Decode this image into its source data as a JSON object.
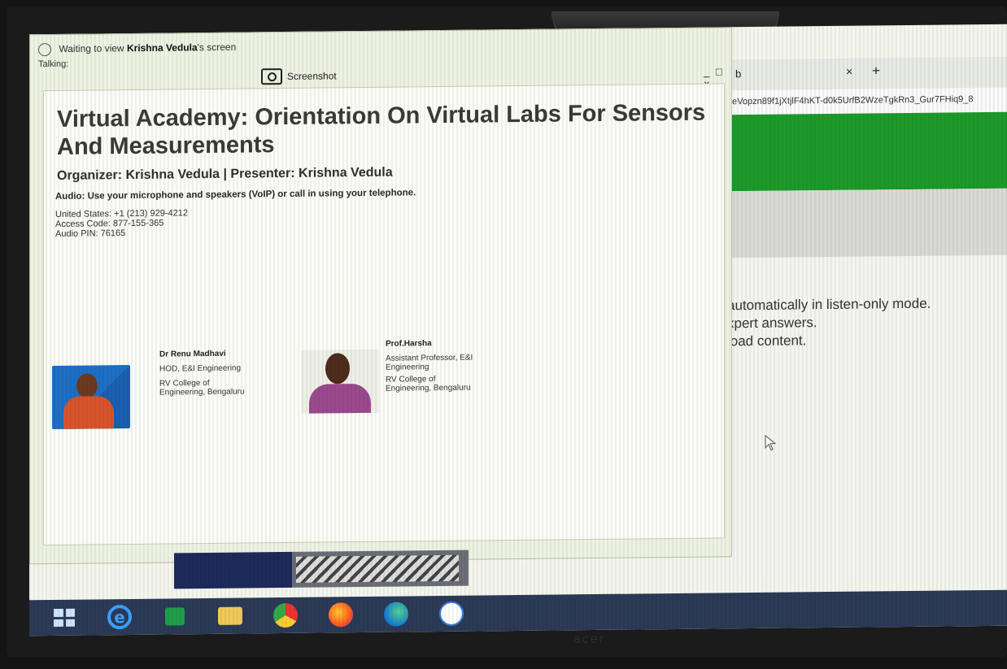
{
  "viewer": {
    "status_prefix": "Waiting to view ",
    "status_name": "Krishna Vedula",
    "status_suffix": "'s screen",
    "talking_label": "Talking:",
    "screenshot_label": "Screenshot",
    "window_controls": "_ □ ×"
  },
  "slide": {
    "title": "Virtual Academy: Orientation On Virtual Labs For Sensors And Measurements",
    "organizer_line": "Organizer: Krishna Vedula  |  Presenter: Krishna Vedula",
    "audio_line": "Audio: Use your microphone and speakers (VoIP) or call in using your telephone.",
    "phone_lines": [
      "United States: +1 (213) 929-4212",
      "Access Code: 877-155-365",
      "Audio PIN: 76165"
    ],
    "presenters": [
      {
        "name": "Dr Renu Madhavi",
        "lines": [
          "HOD, E&I Engineering",
          "RV College of",
          "Engineering, Bengaluru"
        ]
      },
      {
        "name": "Prof.Harsha",
        "lines": [
          "Assistant Professor, E&I",
          "Engineering",
          "RV College of",
          "Engineering, Bengaluru"
        ]
      }
    ]
  },
  "browser": {
    "tab_title": "b",
    "tab_close": "×",
    "tab_new": "+",
    "url": "eVopzn89f1jXtjlF4hKT-d0k5UrfB2WzeTgkRn3_Gur7FHiq9_8",
    "lines": [
      "automatically in listen-only mode.",
      "xpert answers.",
      "load content."
    ],
    "accent": "#1d9a2a"
  },
  "taskbar": {
    "icons": [
      "windows-start-icon",
      "internet-explorer-icon",
      "store-icon",
      "file-explorer-icon",
      "chrome-icon",
      "firefox-icon",
      "edge-icon",
      "gotowebinar-icon"
    ]
  },
  "monitor_brand": "acer"
}
